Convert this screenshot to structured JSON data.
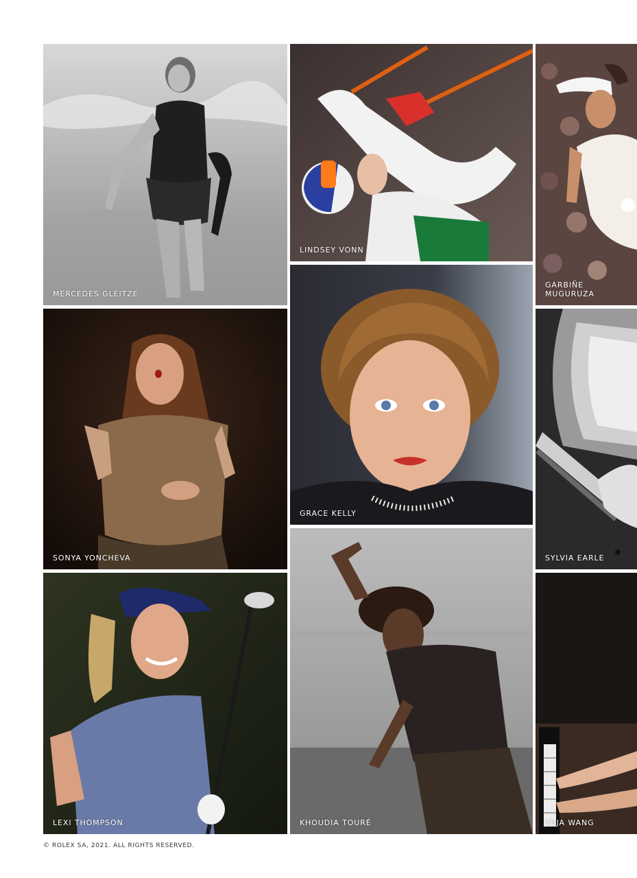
{
  "tiles": {
    "mercedes": {
      "caption": "MERCEDES GLEITZE",
      "photo": "swimmer-on-beach-photo"
    },
    "lindsey": {
      "caption": "LINDSEY VONN",
      "photo": "skier-photo"
    },
    "garbine": {
      "caption": "GARBIÑE\nMUGURUZA",
      "photo": "tennis-player-photo"
    },
    "sonya": {
      "caption": "SONYA YONCHEVA",
      "photo": "opera-singer-photo"
    },
    "grace": {
      "caption": "GRACE KELLY",
      "photo": "actress-portrait-photo"
    },
    "sylvia": {
      "caption": "SYLVIA EARLE",
      "photo": "diving-equipment-photo"
    },
    "lexi": {
      "caption": "LEXI THOMPSON",
      "photo": "golfer-photo"
    },
    "khoudia": {
      "caption": "KHOUDIA TOURÉ",
      "photo": "dancer-photo"
    },
    "yuja": {
      "caption": "YUJA WANG",
      "photo": "pianist-photo"
    }
  },
  "footer": {
    "copyright": "© ROLEX SA, 2021. ALL RIGHTS RESERVED."
  }
}
